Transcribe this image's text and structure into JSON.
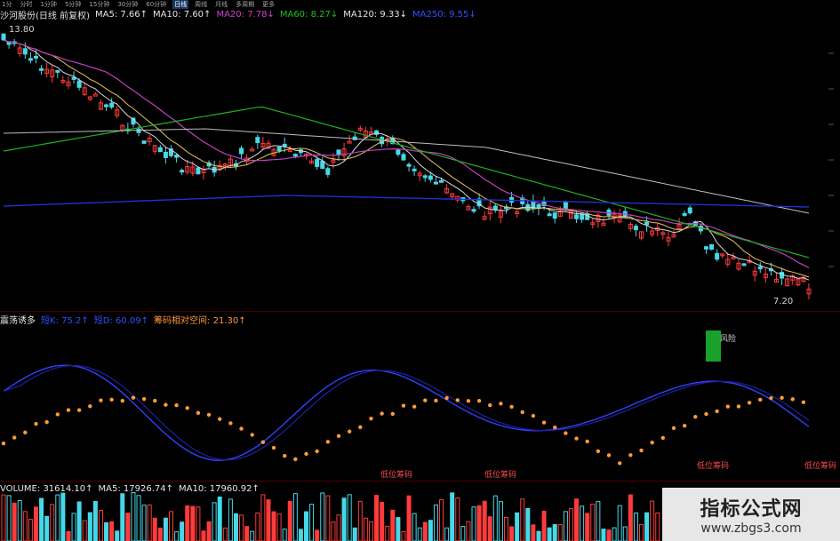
{
  "toolbar": {
    "tabs": [
      "1分",
      "分时",
      "1分钟",
      "5分钟",
      "15分钟",
      "30分钟",
      "60分钟",
      "日线",
      "周线",
      "月线",
      "多周期",
      "更多"
    ],
    "active_tab": "日线"
  },
  "price_panel": {
    "stock_label": "沙河股份(日线 前复权)",
    "indicators": [
      {
        "name": "MA5",
        "value": "7.66",
        "arrow": "↑",
        "color": "#e6e6e6"
      },
      {
        "name": "MA10",
        "value": "7.60",
        "arrow": "↑",
        "color": "#e6e6e6"
      },
      {
        "name": "MA20",
        "value": "7.78",
        "arrow": "↓",
        "color": "#d040d0"
      },
      {
        "name": "MA60",
        "value": "8.27",
        "arrow": "↓",
        "color": "#20c020"
      },
      {
        "name": "MA120",
        "value": "9.33",
        "arrow": "↓",
        "color": "#e6e6e6"
      },
      {
        "name": "MA250",
        "value": "9.55",
        "arrow": "↓",
        "color": "#3050ff"
      }
    ],
    "high_label": "13.80",
    "low_label": "7.20"
  },
  "osc_panel": {
    "name": "震荡诱多",
    "indicators": [
      {
        "name": "短K",
        "value": "75.2",
        "arrow": "↑",
        "color": "#3050ff"
      },
      {
        "name": "短D",
        "value": "60.09",
        "arrow": "↑",
        "color": "#3050ff"
      },
      {
        "name": "筹码相对空间",
        "value": "21.30",
        "arrow": "↑",
        "color": "#ff9a3a"
      }
    ],
    "signal_label": "风险",
    "low_chip_label": "低位筹码"
  },
  "volume_panel": {
    "indicators": [
      {
        "name": "VOLUME",
        "value": "31614.10",
        "arrow": "↑",
        "color": "#e6e6e6"
      },
      {
        "name": "MA5",
        "value": "17926.74",
        "arrow": "↑",
        "color": "#e6e6e6"
      },
      {
        "name": "MA10",
        "value": "17960.92",
        "arrow": "↑",
        "color": "#e6e6e6"
      }
    ]
  },
  "watermark": {
    "line1": "指标公式网",
    "line2": "www.zbgs3.com"
  },
  "colors": {
    "up": "#ff3b3b",
    "down": "#47d8e8",
    "orange_dot": "#ff9a3a",
    "k_line": "#3040ff",
    "d_line": "#2020a0"
  }
}
